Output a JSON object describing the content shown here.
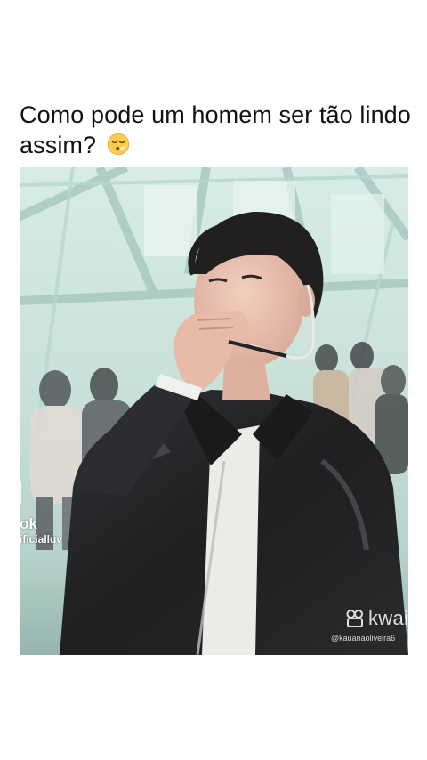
{
  "post": {
    "caption": "Como pode um homem ser tão lindo assim?",
    "caption_emoji_icon": "face-exhaling-emoji"
  },
  "video": {
    "tiktok_brand": "ok",
    "tiktok_handle": "ificialluv",
    "kwai_brand": "kwai",
    "kwai_handle": "@kauanaoliveira6"
  },
  "colors": {
    "caption_text": "#111111",
    "video_bg": "#cfe6df",
    "jacket": "#1a1a1c",
    "watermark": "#ffffff"
  }
}
